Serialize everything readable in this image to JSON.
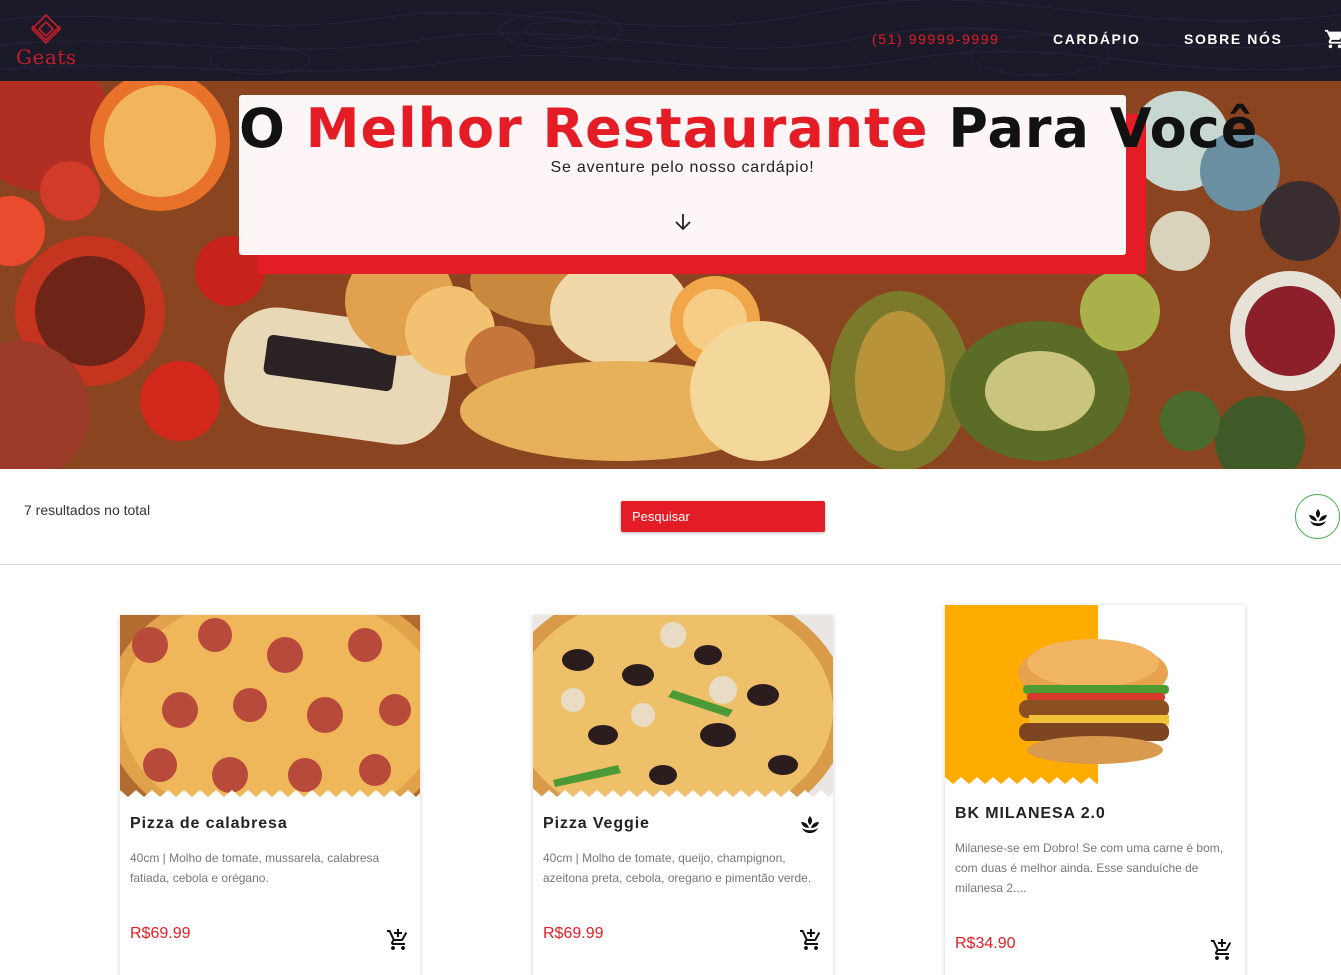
{
  "brand": {
    "name": "Geats",
    "accent": "#e31c25",
    "nav_bg": "#1b1a29"
  },
  "nav": {
    "phone": "(51) 99999-9999",
    "menu": "CARDÁPIO",
    "about": "SOBRE NÓS",
    "cart_icon": "cart-icon"
  },
  "hero": {
    "title_part1": "O ",
    "title_highlight": "Melhor Restaurante",
    "title_part2": " Para Você",
    "subtitle": "Se aventure pelo nosso cardápio!",
    "scroll_icon": "arrow-down-icon"
  },
  "filters": {
    "results_text": "7 resultados no total",
    "search_label": "Pesquisar",
    "veg_filter_icon": "vegetarian-leaf-icon",
    "veg_color": "#4cb050"
  },
  "products": [
    {
      "name": "Pizza de calabresa",
      "description": "40cm | Molho de tomate, mussarela, calabresa fatiada, cebola e orégano.",
      "price": "R$69.99",
      "vegetarian": false
    },
    {
      "name": "Pizza Veggie",
      "description": "40cm | Molho de tomate, queijo, champignon, azeitona preta, cebola, oregano e pimentão verde.",
      "price": "R$69.99",
      "vegetarian": true
    },
    {
      "name": "BK MILANESA 2.0",
      "description": "Milanese-se em Dobro! Se com uma carne é bom, com duas é melhor ainda. Esse sanduíche de milanesa 2....",
      "price": "R$34.90",
      "vegetarian": false
    }
  ]
}
